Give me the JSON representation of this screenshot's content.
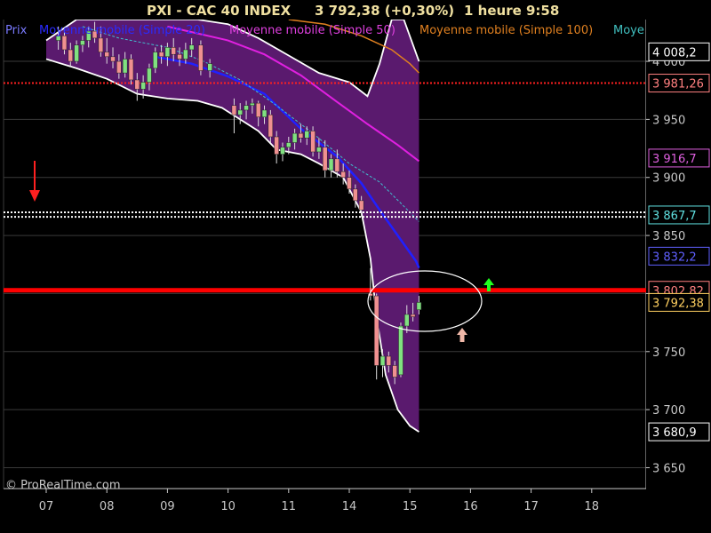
{
  "header": {
    "instrument": "PXI - CAC 40 INDEX",
    "quote": "3 792,38 (+0,30%)",
    "timeframe": "1 heure  9:58"
  },
  "legend": [
    {
      "label": "Prix",
      "color": "#7a7aff"
    },
    {
      "label": "Moyenne mobile (Simple 20)",
      "color": "#2a2aff"
    },
    {
      "label": "Moyenne mobile (Simple 50)",
      "color": "#e040e0"
    },
    {
      "label": "Moyenne mobile (Simple 100)",
      "color": "#e08020"
    },
    {
      "label": "Moye",
      "color": "#40c0c0"
    }
  ],
  "watermark": "© ProRealTime.com",
  "colors": {
    "background": "#000000",
    "grid": "#3a3a3a",
    "band_fill": "#5a1a6e",
    "band_line": "#ffffff",
    "ma20": "#2020ff",
    "ma50": "#e020e0",
    "ma100": "#e08020",
    "ma_cyan": "#40c0d0",
    "candle_up": "#80e080",
    "candle_down": "#f09090",
    "support_line": "#ff0000"
  },
  "price_boxes": [
    {
      "label": "4 008,2",
      "value": 4008.2,
      "color": "#ffffff"
    },
    {
      "label": "3 981,26",
      "value": 3981.26,
      "color": "#ff8080"
    },
    {
      "label": "3 916,7",
      "value": 3916.7,
      "color": "#e060e0"
    },
    {
      "label": "3 867,7",
      "value": 3867.7,
      "color": "#60e0e0"
    },
    {
      "label": "3 832,2",
      "value": 3832.2,
      "color": "#6060ff"
    },
    {
      "label": "3 802,82",
      "value": 3802.82,
      "color": "#ff8080"
    },
    {
      "label": "3 792,38",
      "value": 3792.38,
      "color": "#ffd060"
    },
    {
      "label": "3 680,9",
      "value": 3680.9,
      "color": "#ffffff"
    }
  ],
  "chart_data": {
    "type": "candlestick",
    "title": "PXI - CAC 40 INDEX",
    "timeframe": "1 heure",
    "ylim": [
      3632,
      4036
    ],
    "y_ticks": [
      3650,
      3700,
      3750,
      3800,
      3850,
      3900,
      3950,
      4000
    ],
    "y_tick_labels": [
      "3 650",
      "3 700",
      "3 750",
      "3 800",
      "3 850",
      "3 900",
      "3 950",
      "4 000"
    ],
    "x_ticks": [
      "07",
      "08",
      "09",
      "10",
      "11",
      "14",
      "15",
      "16",
      "17",
      "18"
    ],
    "grid": true,
    "horizontal_lines": [
      {
        "value": 3981.26,
        "style": "dotted",
        "color": "#ff2020"
      },
      {
        "value": 3870,
        "style": "dotted",
        "color": "#ffffff"
      },
      {
        "value": 3866,
        "style": "dotted",
        "color": "#ffffff"
      },
      {
        "value": 3802.82,
        "style": "solid",
        "color": "#ff0000"
      }
    ],
    "candles": [
      {
        "t": 0.2,
        "o": 4018,
        "h": 4030,
        "l": 4010,
        "c": 4022
      },
      {
        "t": 0.3,
        "o": 4022,
        "h": 4028,
        "l": 4006,
        "c": 4010
      },
      {
        "t": 0.4,
        "o": 4010,
        "h": 4016,
        "l": 3995,
        "c": 4000
      },
      {
        "t": 0.5,
        "o": 4000,
        "h": 4018,
        "l": 3998,
        "c": 4014
      },
      {
        "t": 0.6,
        "o": 4014,
        "h": 4022,
        "l": 4008,
        "c": 4018
      },
      {
        "t": 0.7,
        "o": 4018,
        "h": 4030,
        "l": 4012,
        "c": 4026
      },
      {
        "t": 0.8,
        "o": 4026,
        "h": 4034,
        "l": 4016,
        "c": 4020
      },
      {
        "t": 0.9,
        "o": 4020,
        "h": 4030,
        "l": 4004,
        "c": 4008
      },
      {
        "t": 1.0,
        "o": 4008,
        "h": 4020,
        "l": 3998,
        "c": 4004
      },
      {
        "t": 1.1,
        "o": 4004,
        "h": 4012,
        "l": 3994,
        "c": 4000
      },
      {
        "t": 1.2,
        "o": 4000,
        "h": 4006,
        "l": 3985,
        "c": 3990
      },
      {
        "t": 1.3,
        "o": 3990,
        "h": 4008,
        "l": 3986,
        "c": 4002
      },
      {
        "t": 1.4,
        "o": 4002,
        "h": 4006,
        "l": 3980,
        "c": 3984
      },
      {
        "t": 1.5,
        "o": 3984,
        "h": 3990,
        "l": 3966,
        "c": 3976
      },
      {
        "t": 1.6,
        "o": 3976,
        "h": 3988,
        "l": 3968,
        "c": 3982
      },
      {
        "t": 1.7,
        "o": 3982,
        "h": 3998,
        "l": 3975,
        "c": 3994
      },
      {
        "t": 1.8,
        "o": 3994,
        "h": 4012,
        "l": 3990,
        "c": 4008
      },
      {
        "t": 1.9,
        "o": 4008,
        "h": 4014,
        "l": 3998,
        "c": 4004
      },
      {
        "t": 2.0,
        "o": 4004,
        "h": 4016,
        "l": 3996,
        "c": 4012
      },
      {
        "t": 2.1,
        "o": 4012,
        "h": 4020,
        "l": 4000,
        "c": 4006
      },
      {
        "t": 2.2,
        "o": 4006,
        "h": 4012,
        "l": 3996,
        "c": 4002
      },
      {
        "t": 2.3,
        "o": 4002,
        "h": 4016,
        "l": 3998,
        "c": 4010
      },
      {
        "t": 2.4,
        "o": 4010,
        "h": 4020,
        "l": 4004,
        "c": 4014
      },
      {
        "t": 2.55,
        "o": 4014,
        "h": 4018,
        "l": 3988,
        "c": 3992
      },
      {
        "t": 2.7,
        "o": 3992,
        "h": 4002,
        "l": 3986,
        "c": 3998
      },
      {
        "t": 3.1,
        "o": 3962,
        "h": 3968,
        "l": 3938,
        "c": 3954
      },
      {
        "t": 3.2,
        "o": 3954,
        "h": 3964,
        "l": 3946,
        "c": 3958
      },
      {
        "t": 3.3,
        "o": 3958,
        "h": 3966,
        "l": 3950,
        "c": 3962
      },
      {
        "t": 3.4,
        "o": 3962,
        "h": 3968,
        "l": 3955,
        "c": 3964
      },
      {
        "t": 3.5,
        "o": 3964,
        "h": 3966,
        "l": 3944,
        "c": 3952
      },
      {
        "t": 3.6,
        "o": 3952,
        "h": 3962,
        "l": 3946,
        "c": 3958
      },
      {
        "t": 3.7,
        "o": 3954,
        "h": 3958,
        "l": 3930,
        "c": 3935
      },
      {
        "t": 3.8,
        "o": 3935,
        "h": 3940,
        "l": 3912,
        "c": 3920
      },
      {
        "t": 3.9,
        "o": 3920,
        "h": 3930,
        "l": 3914,
        "c": 3926
      },
      {
        "t": 4.0,
        "o": 3926,
        "h": 3935,
        "l": 3920,
        "c": 3930
      },
      {
        "t": 4.1,
        "o": 3930,
        "h": 3942,
        "l": 3924,
        "c": 3938
      },
      {
        "t": 4.2,
        "o": 3938,
        "h": 3946,
        "l": 3930,
        "c": 3934
      },
      {
        "t": 4.3,
        "o": 3934,
        "h": 3944,
        "l": 3928,
        "c": 3940
      },
      {
        "t": 4.4,
        "o": 3940,
        "h": 3944,
        "l": 3918,
        "c": 3922
      },
      {
        "t": 4.5,
        "o": 3922,
        "h": 3934,
        "l": 3916,
        "c": 3926
      },
      {
        "t": 4.6,
        "o": 3926,
        "h": 3932,
        "l": 3900,
        "c": 3906
      },
      {
        "t": 4.7,
        "o": 3906,
        "h": 3920,
        "l": 3900,
        "c": 3916
      },
      {
        "t": 4.8,
        "o": 3916,
        "h": 3924,
        "l": 3900,
        "c": 3905
      },
      {
        "t": 4.9,
        "o": 3905,
        "h": 3912,
        "l": 3894,
        "c": 3900
      },
      {
        "t": 5.0,
        "o": 3900,
        "h": 3906,
        "l": 3886,
        "c": 3890
      },
      {
        "t": 5.1,
        "o": 3890,
        "h": 3894,
        "l": 3874,
        "c": 3880
      },
      {
        "t": 5.2,
        "o": 3880,
        "h": 3884,
        "l": 3866,
        "c": 3872
      },
      {
        "t": 5.35,
        "o": 3800,
        "h": 3822,
        "l": 3794,
        "c": 3798
      },
      {
        "t": 5.45,
        "o": 3798,
        "h": 3800,
        "l": 3726,
        "c": 3738
      },
      {
        "t": 5.55,
        "o": 3738,
        "h": 3752,
        "l": 3728,
        "c": 3746
      },
      {
        "t": 5.65,
        "o": 3746,
        "h": 3750,
        "l": 3732,
        "c": 3738
      },
      {
        "t": 5.75,
        "o": 3738,
        "h": 3742,
        "l": 3722,
        "c": 3728
      },
      {
        "t": 5.85,
        "o": 3730,
        "h": 3775,
        "l": 3728,
        "c": 3772
      },
      {
        "t": 5.95,
        "o": 3772,
        "h": 3790,
        "l": 3766,
        "c": 3782
      },
      {
        "t": 6.05,
        "o": 3782,
        "h": 3792,
        "l": 3776,
        "c": 3780
      },
      {
        "t": 6.15,
        "o": 3786,
        "h": 3798,
        "l": 3782,
        "c": 3792.38
      }
    ],
    "series": [
      {
        "name": "Moyenne mobile (Simple 20)",
        "points": [
          [
            1.8,
            4004
          ],
          [
            2.4,
            3998
          ],
          [
            3.0,
            3987
          ],
          [
            3.6,
            3972
          ],
          [
            4.2,
            3942
          ],
          [
            4.8,
            3918
          ],
          [
            5.2,
            3895
          ],
          [
            5.5,
            3872
          ],
          [
            5.8,
            3850
          ],
          [
            6.1,
            3828
          ],
          [
            6.15,
            3822
          ]
        ]
      },
      {
        "name": "Moyenne mobile (Simple 50)",
        "points": [
          [
            2.0,
            4030
          ],
          [
            3.0,
            4018
          ],
          [
            3.6,
            4006
          ],
          [
            4.2,
            3988
          ],
          [
            4.8,
            3965
          ],
          [
            5.3,
            3946
          ],
          [
            5.8,
            3928
          ],
          [
            6.15,
            3914
          ]
        ]
      },
      {
        "name": "Moyenne mobile (Simple 100)",
        "points": [
          [
            4.0,
            4036
          ],
          [
            4.6,
            4032
          ],
          [
            5.2,
            4022
          ],
          [
            5.7,
            4010
          ],
          [
            6.0,
            3998
          ],
          [
            6.15,
            3990
          ]
        ]
      },
      {
        "name": "Moye",
        "points": [
          [
            0.6,
            4030
          ],
          [
            1.2,
            4020
          ],
          [
            2.0,
            4012
          ],
          [
            2.6,
            4000
          ],
          [
            3.2,
            3984
          ],
          [
            3.8,
            3962
          ],
          [
            4.4,
            3938
          ],
          [
            5.0,
            3912
          ],
          [
            5.5,
            3896
          ],
          [
            6.0,
            3870
          ],
          [
            6.15,
            3862
          ]
        ]
      }
    ],
    "band": {
      "upper": [
        [
          0.0,
          4018
        ],
        [
          0.5,
          4036
        ],
        [
          1.5,
          4036
        ],
        [
          2.5,
          4036
        ],
        [
          3.0,
          4032
        ],
        [
          3.5,
          4020
        ],
        [
          4.0,
          4005
        ],
        [
          4.5,
          3990
        ],
        [
          5.0,
          3982
        ],
        [
          5.3,
          3970
        ],
        [
          5.5,
          3998
        ],
        [
          5.7,
          4036
        ],
        [
          5.9,
          4036
        ],
        [
          6.15,
          4000
        ]
      ],
      "lower": [
        [
          0.0,
          4002
        ],
        [
          0.5,
          3994
        ],
        [
          1.0,
          3985
        ],
        [
          1.5,
          3972
        ],
        [
          2.0,
          3968
        ],
        [
          2.5,
          3966
        ],
        [
          2.9,
          3960
        ],
        [
          3.2,
          3950
        ],
        [
          3.5,
          3940
        ],
        [
          3.8,
          3924
        ],
        [
          4.2,
          3920
        ],
        [
          4.5,
          3912
        ],
        [
          4.9,
          3900
        ],
        [
          5.2,
          3870
        ],
        [
          5.35,
          3830
        ],
        [
          5.45,
          3780
        ],
        [
          5.6,
          3730
        ],
        [
          5.8,
          3700
        ],
        [
          6.0,
          3686
        ],
        [
          6.15,
          3680.9
        ]
      ]
    }
  }
}
